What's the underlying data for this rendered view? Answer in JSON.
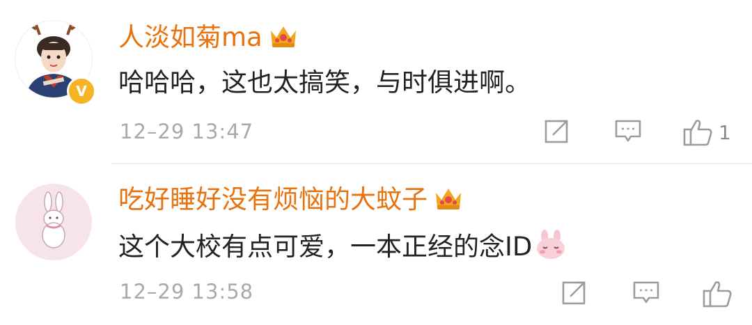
{
  "comments": [
    {
      "username": "人淡如菊ma",
      "text": "哈哈哈，这也太搞笑，与时俱进啊。",
      "time": "12–29 13:47",
      "like_count": "1",
      "verified_badge": "V",
      "icons": [
        "avatar",
        "verified-badge-icon",
        "crown-icon",
        "share-icon",
        "reply-icon",
        "like-icon"
      ]
    },
    {
      "username": "吃好睡好没有烦恼的大蚊子",
      "text": "这个大校有点可爱，一本正经的念ID",
      "time": "12–29 13:58",
      "like_count": "",
      "icons": [
        "avatar",
        "crown-icon",
        "bunny-emoji-icon",
        "share-icon",
        "reply-icon",
        "like-icon"
      ]
    }
  ],
  "colors": {
    "username": "#e8730e",
    "text": "#222222",
    "meta": "#a9a9a9",
    "icon": "#9b9b9b",
    "crown": "#f2a51f"
  }
}
